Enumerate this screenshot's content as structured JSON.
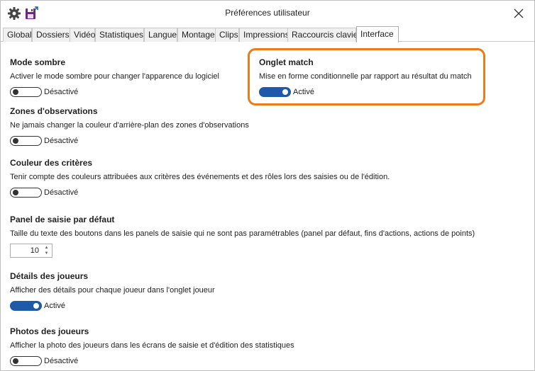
{
  "window": {
    "title": "Préférences utilisateur",
    "icons": [
      "gear-icon",
      "save-icon",
      "close-icon"
    ]
  },
  "tabs": [
    {
      "label": "Global"
    },
    {
      "label": "Dossiers"
    },
    {
      "label": "Vidéo"
    },
    {
      "label": "Statistiques"
    },
    {
      "label": "Langue"
    },
    {
      "label": "Montage"
    },
    {
      "label": "Clips"
    },
    {
      "label": "Impressions"
    },
    {
      "label": "Raccourcis clavier"
    },
    {
      "label": "Interface",
      "active": true
    }
  ],
  "sections": {
    "dark_mode": {
      "title": "Mode sombre",
      "desc": "Activer le mode sombre pour changer l'apparence du logiciel",
      "state": "Désactivé"
    },
    "match_tab": {
      "title": "Onglet match",
      "desc": "Mise en forme conditionnelle par rapport au résultat du match",
      "state": "Activé"
    },
    "observation_zones": {
      "title": "Zones d'observations",
      "desc": "Ne jamais changer la couleur d'arrière-plan des zones d'observations",
      "state": "Désactivé"
    },
    "criteria_color": {
      "title": "Couleur des critères",
      "desc": "Tenir compte des couleurs attribuées aux critères des événements et des rôles lors des saisies ou de l'édition.",
      "state": "Désactivé"
    },
    "default_panel": {
      "title": "Panel de saisie par défaut",
      "desc": "Taille du texte des boutons dans les panels de saisie qui ne sont pas paramétrables (panel par défaut, fins d'actions, actions de points)",
      "value": "10"
    },
    "player_details": {
      "title": "Détails des joueurs",
      "desc": "Afficher des détails pour chaque joueur dans l'onglet joueur",
      "state": "Activé"
    },
    "player_photos": {
      "title": "Photos des joueurs",
      "desc": "Afficher la photo des joueurs dans les écrans de saisie et d'édition des statistiques",
      "state": "Désactivé"
    }
  },
  "colors": {
    "toggle_on": "#1e5aa8",
    "highlight": "#f07a1a"
  }
}
